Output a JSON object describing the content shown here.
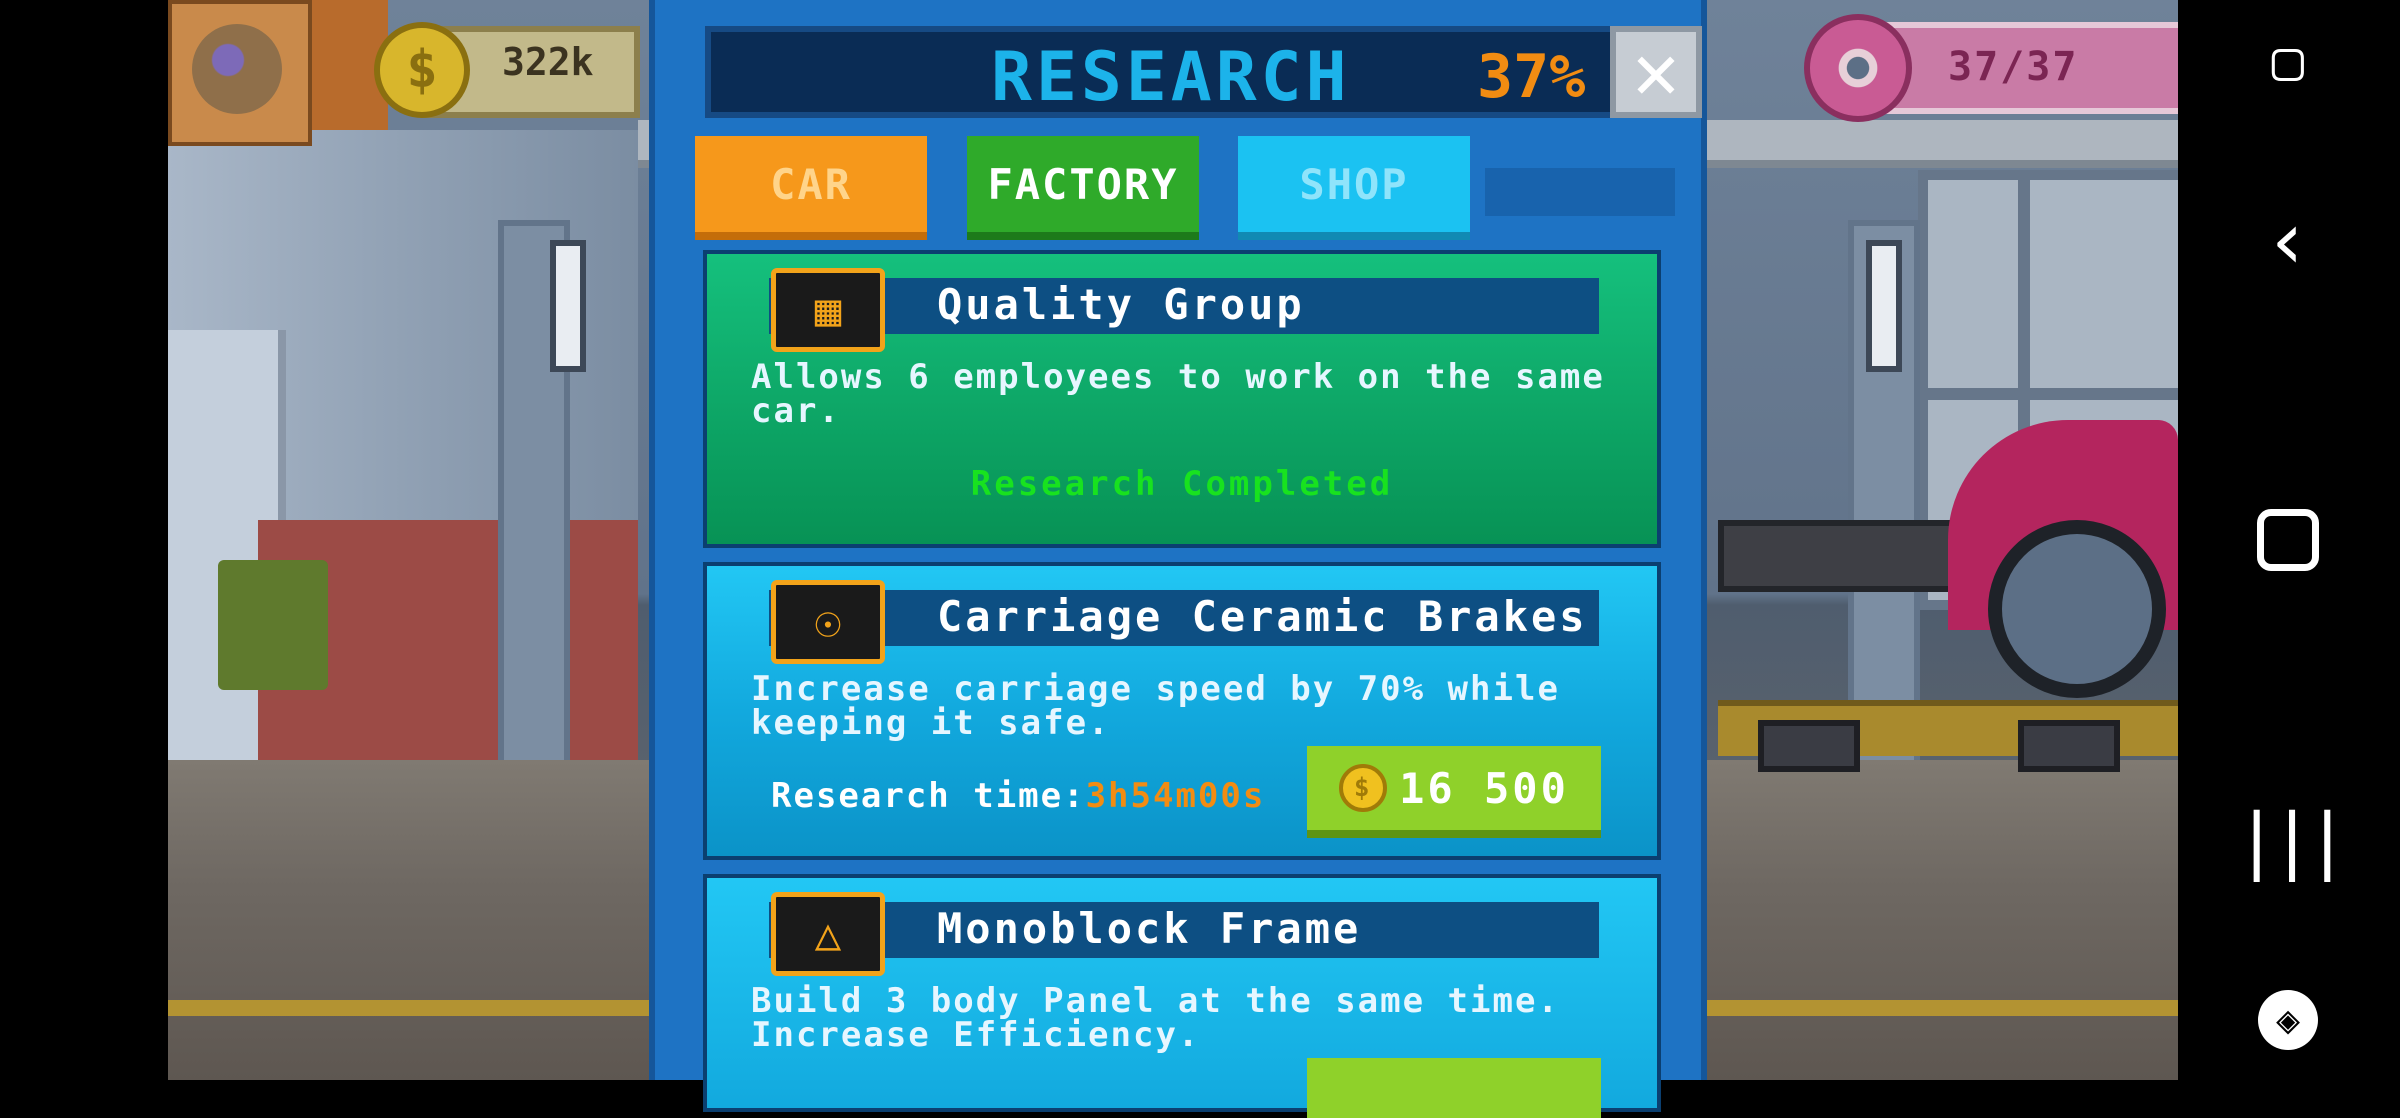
{
  "hud": {
    "money": "322k",
    "money_icon": "dollar-coin-icon",
    "donuts": "37/37",
    "donut_icon": "donut-icon"
  },
  "research": {
    "title": "RESEARCH",
    "percent": "37%",
    "close_label": "✕",
    "tabs": [
      {
        "label": "CAR",
        "active": false,
        "color": "#f6981b"
      },
      {
        "label": "FACTORY",
        "active": true,
        "color": "#2faa2a"
      },
      {
        "label": "SHOP",
        "active": false,
        "color": "#1bc2f2"
      }
    ],
    "items": [
      {
        "title": "Quality Group",
        "icon": "employees-icon",
        "description": "Allows 6 employees to work on the same car.",
        "status": "Research Completed"
      },
      {
        "title": "Carriage Ceramic Brakes",
        "icon": "brake-disc-icon",
        "description": "Increase carriage speed by 70% while keeping it safe.",
        "research_time_label": "Research time:",
        "research_time_value": "3h54m00s",
        "price": "16 500"
      },
      {
        "title": "Monoblock Frame",
        "icon": "car-frame-icon",
        "description": "Build 3 body Panel at the same time. Increase Efficiency."
      }
    ]
  },
  "navbar": {
    "back_glyph": "‹",
    "recent_glyph": "|||"
  },
  "colors": {
    "panel_bg": "#1e73c4",
    "completed_green": "#18e21f",
    "accent_orange": "#f28c12",
    "title_cyan": "#1cb3ea"
  }
}
